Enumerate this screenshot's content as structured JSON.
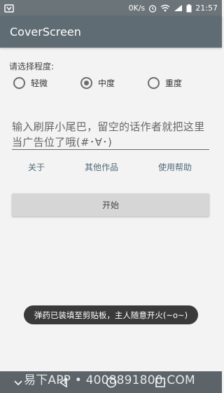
{
  "status_bar": {
    "speed": "0K/s",
    "time": "21:57",
    "icons": [
      "notification-icon",
      "alarm-icon",
      "wifi-icon",
      "signal-icon",
      "battery-icon"
    ]
  },
  "app_bar": {
    "title": "CoverScreen"
  },
  "degree": {
    "label": "请选择程度:",
    "options": [
      {
        "label": "轻微",
        "checked": false
      },
      {
        "label": "中度",
        "checked": true
      },
      {
        "label": "重度",
        "checked": false
      }
    ]
  },
  "tail_input": {
    "placeholder": "输入刷屏小尾巴，留空的话作者就把这里当广告位了哦(#･∀･)"
  },
  "links": {
    "about": "关于",
    "other_works": "其他作品",
    "help": "使用帮助"
  },
  "start_button": {
    "label": "开始"
  },
  "toast": {
    "message": "弹药已装填至剪贴板，主人随意开火(~o~)"
  },
  "watermark": {
    "text": "易下APP • 4008891800.COM"
  },
  "nav_bar": {
    "icons": [
      "hide-keyboard-icon",
      "back-icon",
      "home-icon",
      "recent-apps-icon"
    ]
  },
  "colors": {
    "app_bar": "#5f6c74",
    "status_bar": "#6b7478",
    "background": "#f3f3f3",
    "toast": "#3a3a3a"
  }
}
